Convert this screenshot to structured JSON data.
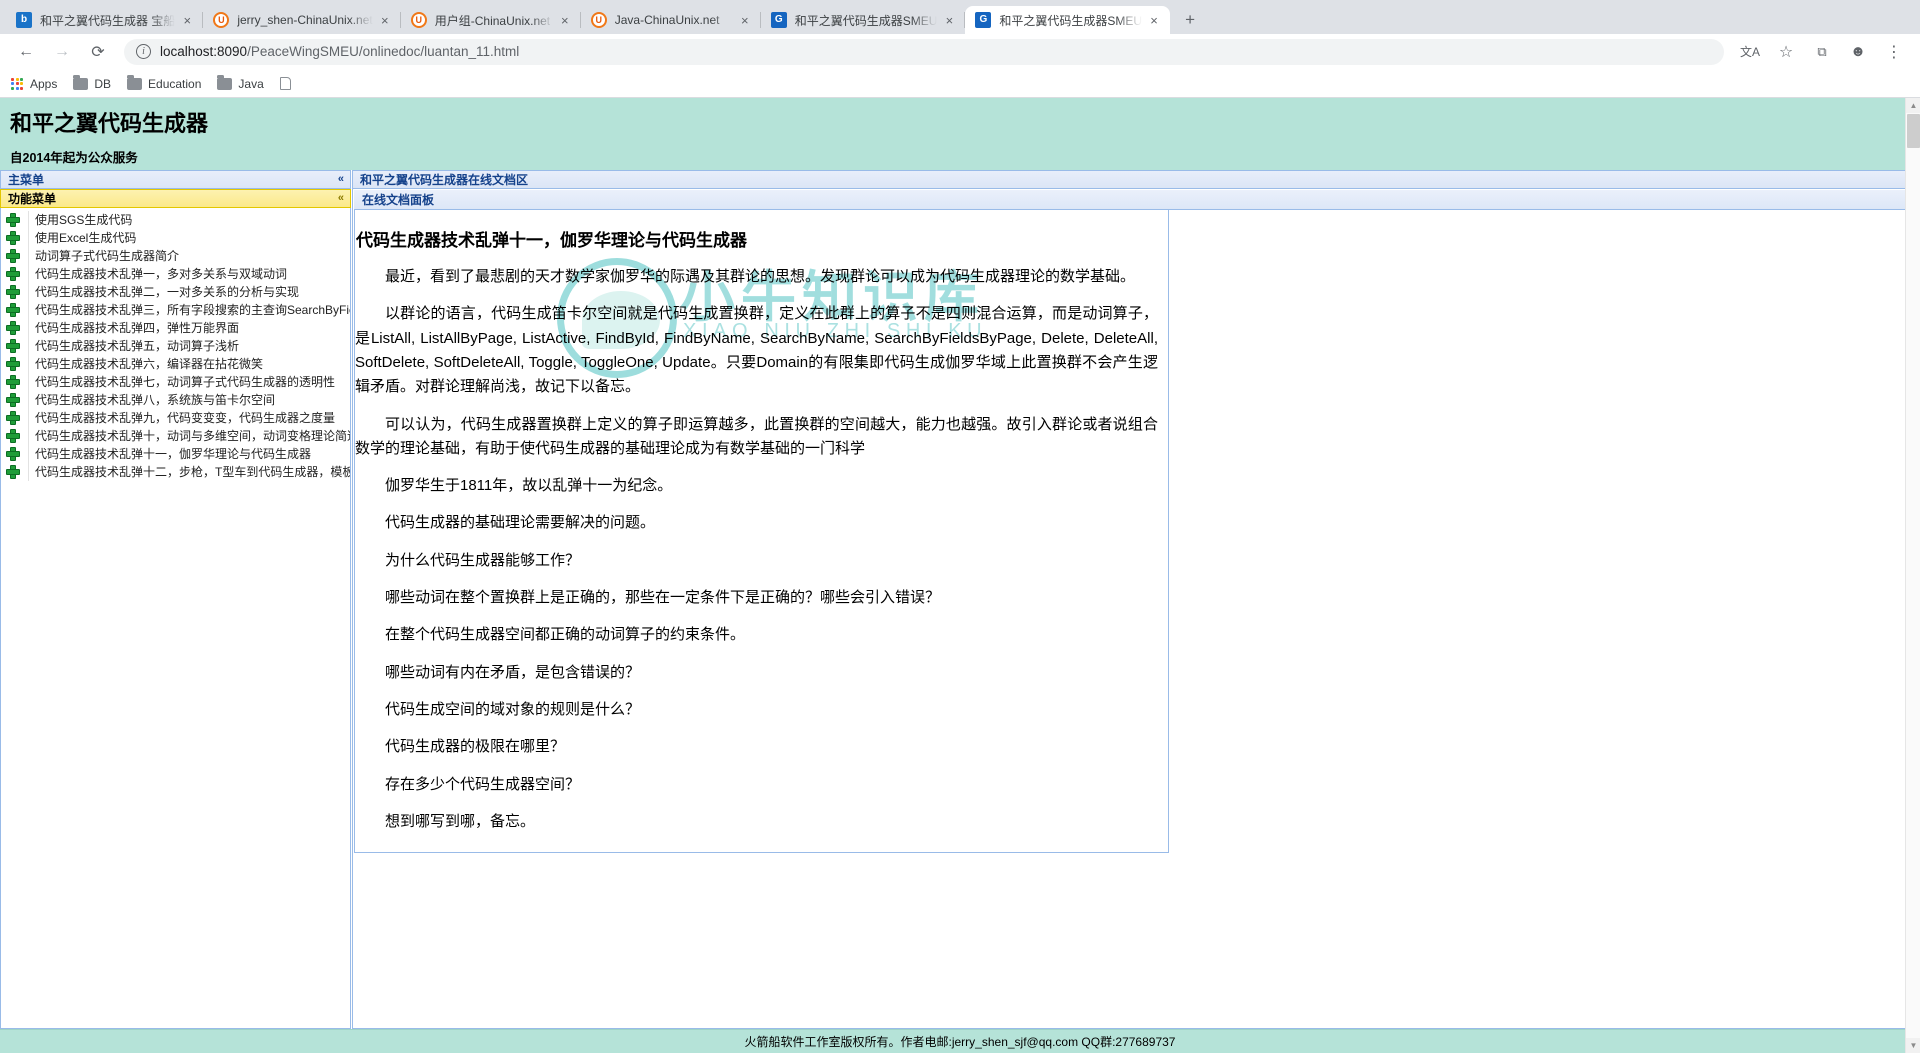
{
  "browser": {
    "tabs": [
      {
        "title": "和平之翼代码生成器 宝船",
        "favicon": "bing-icon",
        "active": false
      },
      {
        "title": "jerry_shen-ChinaUnix.net",
        "favicon": "chinaunix-icon",
        "active": false
      },
      {
        "title": "用户组-ChinaUnix.net",
        "favicon": "chinaunix-icon",
        "active": false
      },
      {
        "title": "Java-ChinaUnix.net",
        "favicon": "chinaunix-icon",
        "active": false
      },
      {
        "title": "和平之翼代码生成器SMEU",
        "favicon": "app-icon",
        "active": false
      },
      {
        "title": "和平之翼代码生成器SMEU",
        "favicon": "app-icon",
        "active": true
      }
    ],
    "new_tab_label": "+",
    "close_label": "×",
    "nav": {
      "back": "←",
      "forward": "→",
      "reload": "⟳",
      "translate": "文A",
      "bookmark_star": "☆",
      "extension": "⬚",
      "profile": "●",
      "menu": "⋮"
    },
    "omnibox": {
      "info_glyph": "i",
      "host": "localhost:8090",
      "path": "/PeaceWingSMEU/onlinedoc/luantan_11.html"
    },
    "bookmarks": [
      {
        "label": "Apps",
        "icon": "apps-grid-icon"
      },
      {
        "label": "DB",
        "icon": "folder-icon"
      },
      {
        "label": "Education",
        "icon": "folder-icon"
      },
      {
        "label": "Java",
        "icon": "folder-icon"
      },
      {
        "label": "",
        "icon": "document-icon"
      }
    ]
  },
  "site": {
    "title": "和平之翼代码生成器",
    "subtitle": "自2014年起为公众服务",
    "footer": "火箭船软件工作室版权所有。作者电邮:jerry_shen_sjf@qq.com QQ群:277689737"
  },
  "sidebar": {
    "main_menu_label": "主菜单",
    "main_menu_chevron": "«",
    "function_menu_label": "功能菜单",
    "function_menu_chevron": "«",
    "items": [
      {
        "label": "使用SGS生成代码",
        "icon": "plus-badge-icon"
      },
      {
        "label": "使用Excel生成代码",
        "icon": "plus-badge-icon"
      },
      {
        "label": "动词算子式代码生成器简介",
        "icon": "plus-badge-icon"
      },
      {
        "label": "代码生成器技术乱弹一，多对多关系与双域动词",
        "icon": "plus-badge-icon"
      },
      {
        "label": "代码生成器技术乱弹二，一对多关系的分析与实现",
        "icon": "plus-badge-icon"
      },
      {
        "label": "代码生成器技术乱弹三，所有字段搜索的主查询SearchByFieldsByPage",
        "icon": "plus-badge-icon"
      },
      {
        "label": "代码生成器技术乱弹四，弹性万能界面",
        "icon": "plus-badge-icon"
      },
      {
        "label": "代码生成器技术乱弹五，动词算子浅析",
        "icon": "plus-badge-icon"
      },
      {
        "label": "代码生成器技术乱弹六，编译器在拈花微笑",
        "icon": "plus-badge-icon"
      },
      {
        "label": "代码生成器技术乱弹七，动词算子式代码生成器的透明性",
        "icon": "plus-badge-icon"
      },
      {
        "label": "代码生成器技术乱弹八，系统族与笛卡尔空间",
        "icon": "plus-badge-icon"
      },
      {
        "label": "代码生成器技术乱弹九，代码变变变，代码生成器之度量",
        "icon": "plus-badge-icon"
      },
      {
        "label": "代码生成器技术乱弹十，动词与多维空间，动词变格理论简述",
        "icon": "plus-badge-icon"
      },
      {
        "label": "代码生成器技术乱弹十一，伽罗华理论与代码生成器",
        "icon": "plus-badge-icon"
      },
      {
        "label": "代码生成器技术乱弹十二，步枪，T型车到代码生成器，模板法的工业魔术",
        "icon": "plus-badge-icon"
      }
    ]
  },
  "doc": {
    "region_title": "和平之翼代码生成器在线文档区",
    "panel_title": "在线文档面板",
    "collapse_chevron": "«",
    "title": "代码生成器技术乱弹十一，伽罗华理论与代码生成器",
    "watermark_line1": "小牛知识库",
    "watermark_line2": "XIAO NIU ZHI SHI KU",
    "paragraphs": [
      {
        "text": "最近，看到了最悲剧的天才数学家伽罗华的际遇及其群论的思想。发现群论可以成为代码生成器理论的数学基础。",
        "indent": true
      },
      {
        "text": "以群论的语言，代码生成笛卡尔空间就是代码生成置换群，定义在此群上的算子不是四则混合运算，而是动词算子，是ListAll, ListAllByPage, ListActive, FindById, FindByName, SearchByName, SearchByFieldsByPage, Delete, DeleteAll, SoftDelete, SoftDeleteAll, Toggle, ToggleOne, Update。只要Domain的有限集即代码生成伽罗华域上此置换群不会产生逻辑矛盾。对群论理解尚浅，故记下以备忘。",
        "indent": true
      },
      {
        "text": "可以认为，代码生成器置换群上定义的算子即运算越多，此置换群的空间越大，能力也越强。故引入群论或者说组合数学的理论基础，有助于使代码生成器的基础理论成为有数学基础的一门科学",
        "indent": true
      },
      {
        "text": "伽罗华生于1811年，故以乱弹十一为纪念。",
        "indent": true
      },
      {
        "text": "代码生成器的基础理论需要解决的问题。",
        "indent": true
      },
      {
        "text": "为什么代码生成器能够工作？",
        "indent": true
      },
      {
        "text": "哪些动词在整个置换群上是正确的，那些在一定条件下是正确的？哪些会引入错误？",
        "indent": true
      },
      {
        "text": "在整个代码生成器空间都正确的动词算子的约束条件。",
        "indent": true
      },
      {
        "text": "哪些动词有内在矛盾，是包含错误的？",
        "indent": true
      },
      {
        "text": "代码生成空间的域对象的规则是什么？",
        "indent": true
      },
      {
        "text": "代码生成器的极限在哪里？",
        "indent": true
      },
      {
        "text": "存在多少个代码生成器空间？",
        "indent": true
      },
      {
        "text": "想到哪写到哪，备忘。",
        "indent": true
      }
    ]
  },
  "colors": {
    "banner": "#b5e3d8",
    "panel_header": "#dce6f7",
    "accordion_open": "#fbe98a",
    "panel_border": "#99bbe8",
    "link_text": "#15428b",
    "icon_green": "#1f9d39",
    "watermark": "#5ec8c8"
  }
}
